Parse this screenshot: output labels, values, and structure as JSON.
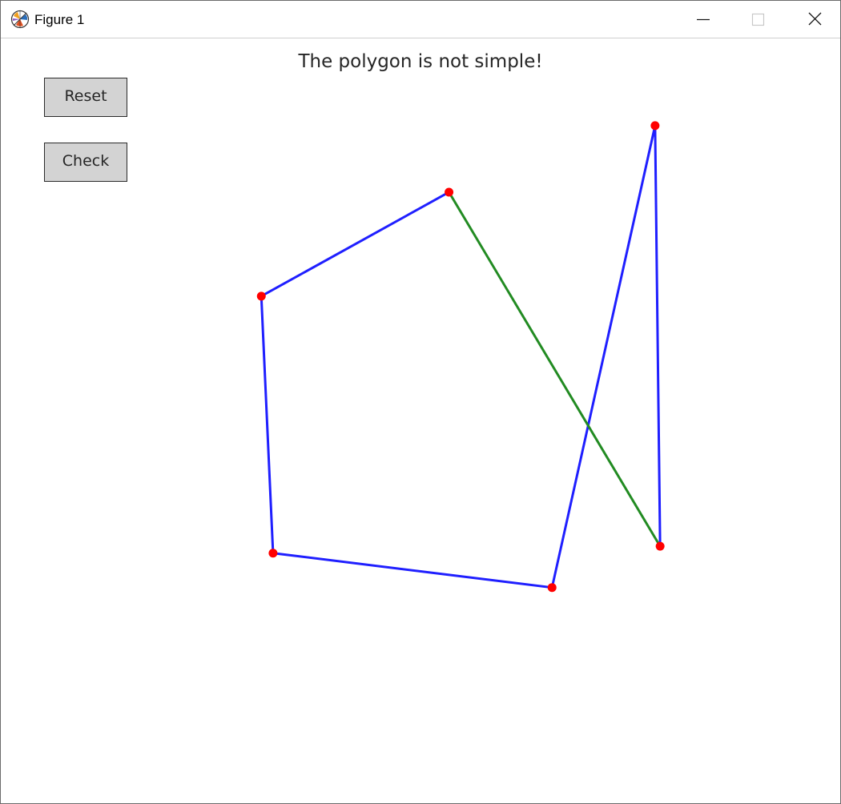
{
  "window": {
    "title": "Figure 1",
    "icon": "matplotlib-icon",
    "controls": [
      "minimize-icon",
      "maximize-icon",
      "close-icon"
    ]
  },
  "figure": {
    "title": "The polygon is not simple!",
    "buttons": {
      "reset_label": "Reset",
      "check_label": "Check"
    }
  },
  "colors": {
    "edge": "#1f1fff",
    "closing_edge": "#228b22",
    "vertex": "#ff0000",
    "button_face": "#d3d3d3"
  },
  "chart_data": {
    "type": "polygon",
    "vertices": [
      [
        0.534,
        0.799
      ],
      [
        0.31,
        0.663
      ],
      [
        0.324,
        0.327
      ],
      [
        0.657,
        0.282
      ],
      [
        0.78,
        0.886
      ],
      [
        0.786,
        0.336
      ]
    ],
    "closing_edge": [
      5,
      0
    ],
    "xlim": [
      0,
      1
    ],
    "ylim": [
      0,
      1
    ],
    "grid": false
  }
}
